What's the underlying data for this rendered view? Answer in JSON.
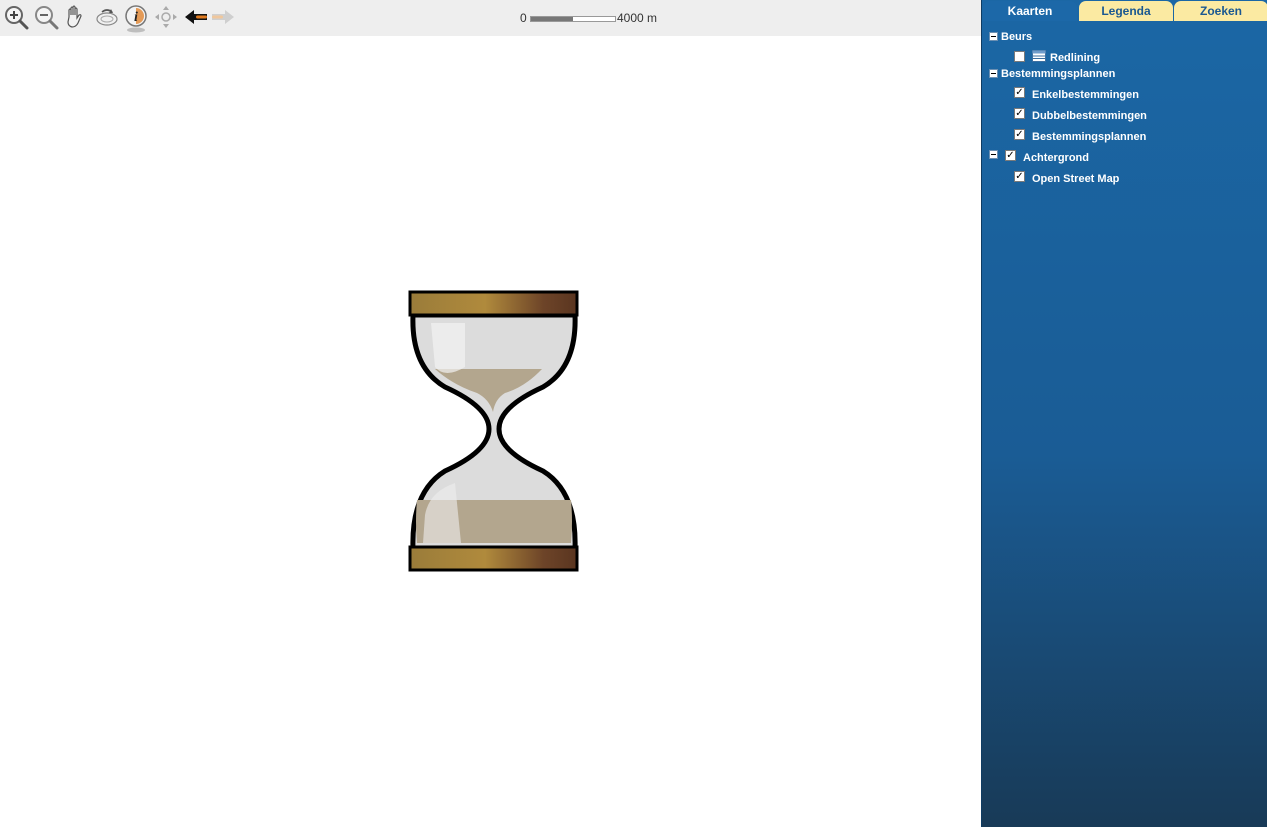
{
  "toolbar": {
    "tools": [
      {
        "icon": "zoom-in-icon"
      },
      {
        "icon": "zoom-out-icon"
      },
      {
        "icon": "pan-hand-icon"
      },
      {
        "icon": "full-extent-icon"
      },
      {
        "icon": "identify-info-icon",
        "active": true
      },
      {
        "icon": "pan-arrows-icon"
      },
      {
        "icon": "previous-extent-arrow-icon"
      },
      {
        "icon": "next-extent-arrow-icon"
      }
    ]
  },
  "scalebar": {
    "start_label": "0",
    "end_label": "4000 m"
  },
  "loading": {
    "icon": "hourglass-icon"
  },
  "panel": {
    "tabs": [
      {
        "label": "Kaarten",
        "active": true
      },
      {
        "label": "Legenda",
        "active": false
      },
      {
        "label": "Zoeken",
        "active": false
      }
    ],
    "tree": {
      "beurs": {
        "label": "Beurs",
        "children": [
          {
            "label": "Redlining",
            "checked": false,
            "icon": "table-layer-icon"
          }
        ]
      },
      "bestemmingsplannen": {
        "label": "Bestemmingsplannen",
        "children": [
          {
            "label": "Enkelbestemmingen",
            "checked": true
          },
          {
            "label": "Dubbelbestemmingen",
            "checked": true
          },
          {
            "label": "Bestemmingsplannen",
            "checked": true
          }
        ]
      },
      "achtergrond": {
        "label": "Achtergrond",
        "checked": true,
        "children": [
          {
            "label": "Open Street Map",
            "checked": true
          }
        ]
      }
    }
  },
  "colors": {
    "panel_blue": "#1b67a5",
    "tab_inactive": "#fbeaa2",
    "tab_text": "#1a5891",
    "toolbar_bg": "#eeeeee"
  }
}
